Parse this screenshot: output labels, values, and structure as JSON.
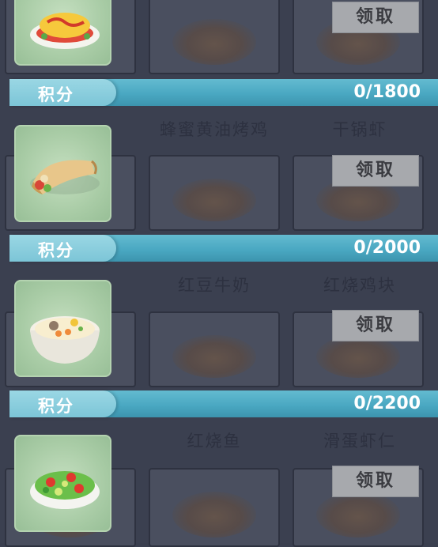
{
  "claim_label": "领取",
  "points_label": "积分",
  "tiers": [
    {
      "progress": "0/1800"
    },
    {
      "progress": "0/2000"
    },
    {
      "progress": "0/2200"
    }
  ],
  "dish_names": [
    {
      "col1": "蜂蜜黄油烤鸡",
      "col2": "干锅虾"
    },
    {
      "col1": "红豆牛奶",
      "col2": "红烧鸡块"
    },
    {
      "col1": "红烧鱼",
      "col2": "滑蛋虾仁"
    }
  ],
  "thumbnails": [
    "omelette-rice-icon",
    "burrito-wrap-icon",
    "congee-bowl-icon",
    "salad-bowl-icon"
  ]
}
